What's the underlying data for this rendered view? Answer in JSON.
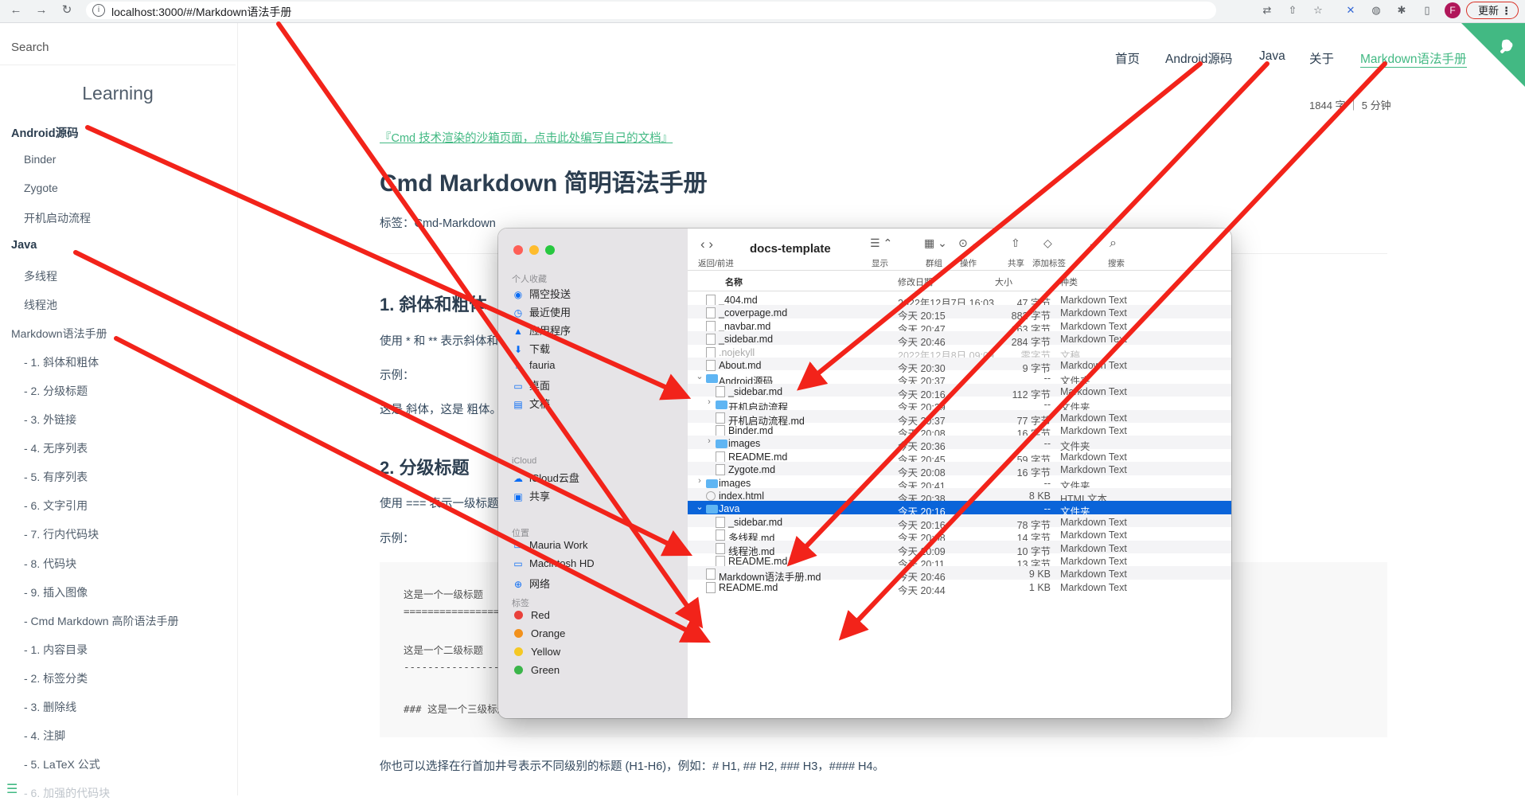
{
  "browser": {
    "url": "localhost:3000/#/Markdown语法手册",
    "avatar": "F",
    "update_label": "更新",
    "menu_glyph": "⋮"
  },
  "sidebar": {
    "search_placeholder": "Search",
    "app_name": "Learning",
    "items": [
      {
        "label": "Android源码",
        "level": 0
      },
      {
        "label": "Binder",
        "level": 1
      },
      {
        "label": "Zygote",
        "level": 1
      },
      {
        "label": "开机启动流程",
        "level": 1
      },
      {
        "label": "Java",
        "level": 0
      },
      {
        "label": "多线程",
        "level": 1
      },
      {
        "label": "线程池",
        "level": 1
      },
      {
        "label": "Markdown语法手册",
        "level": 0
      },
      {
        "label": "- 1. 斜体和粗体",
        "level": 1
      },
      {
        "label": "- 2. 分级标题",
        "level": 1
      },
      {
        "label": "- 3. 外链接",
        "level": 1
      },
      {
        "label": "- 4. 无序列表",
        "level": 1
      },
      {
        "label": "- 5. 有序列表",
        "level": 1
      },
      {
        "label": "- 6. 文字引用",
        "level": 1
      },
      {
        "label": "- 7. 行内代码块",
        "level": 1
      },
      {
        "label": "- 8. 代码块",
        "level": 1
      },
      {
        "label": "- 9. 插入图像",
        "level": 1
      },
      {
        "label": "- Cmd Markdown 高阶语法手册",
        "level": 1
      },
      {
        "label": "- 1. 内容目录",
        "level": 1
      },
      {
        "label": "- 2. 标签分类",
        "level": 1
      },
      {
        "label": "- 3. 删除线",
        "level": 1
      },
      {
        "label": "- 4. 注脚",
        "level": 1
      },
      {
        "label": "- 5. LaTeX 公式",
        "level": 1
      },
      {
        "label": "- 6. 加强的代码块",
        "level": 1
      }
    ]
  },
  "topnav": [
    "首页",
    "Android源码",
    "Java",
    "关于",
    "Markdown语法手册"
  ],
  "content": {
    "wordcount": "1844 字 ｜ 5 分钟",
    "sandbox_link": "『Cmd 技术渲染的沙箱页面，点击此处编写自己的文档』",
    "title": "Cmd Markdown 简明语法手册",
    "tags": "标签：Cmd-Markdown",
    "h2_1": "1. 斜体和粗体",
    "p1": "使用 * 和 ** 表示斜体和粗体。",
    "example1": "示例：",
    "p2": "这是 斜体，这是 粗体。",
    "h2_2": "2. 分级标题",
    "p3": "使用 === 表示一级标题，使用 --- 表示二级标题。",
    "example2": "示例：",
    "code": [
      "这是一个一级标题",
      "============================",
      "这是一个二级标题",
      "--------------------------------",
      "### 这是一个三级标题"
    ],
    "p4": "你也可以选择在行首加井号表示不同级别的标题 (H1-H6)，例如：# H1, ## H2, ### H3，#### H4。"
  },
  "finder": {
    "title": "docs-template",
    "toolbar": [
      {
        "icon": "‹ ›",
        "label": "返回/前进"
      },
      {
        "icon": "☰ ⌃",
        "label": "显示"
      },
      {
        "icon": "▦ ⌄",
        "label": "群组"
      },
      {
        "icon": "⊙ ⌄",
        "label": "操作"
      },
      {
        "icon": "⇧",
        "label": "共享"
      },
      {
        "icon": "◇",
        "label": "添加标签"
      },
      {
        "icon": "⌄",
        "label": ""
      },
      {
        "icon": "⌕",
        "label": "搜索"
      }
    ],
    "columns": {
      "name": "名称",
      "date": "修改日期",
      "size": "大小",
      "kind": "种类"
    },
    "sidebar": {
      "favorites_title": "个人收藏",
      "favorites": [
        {
          "icon": "◉",
          "label": "隔空投送"
        },
        {
          "icon": "◷",
          "label": "最近使用"
        },
        {
          "icon": "▲",
          "label": "应用程序"
        },
        {
          "icon": "⬇",
          "label": "下载"
        },
        {
          "icon": "⌂",
          "label": "fauria"
        },
        {
          "icon": "▭",
          "label": "桌面"
        },
        {
          "icon": "▤",
          "label": "文稿"
        }
      ],
      "icloud_title": "iCloud",
      "icloud": [
        {
          "icon": "☁",
          "label": "iCloud云盘"
        },
        {
          "icon": "▣",
          "label": "共享"
        }
      ],
      "locations_title": "位置",
      "locations": [
        {
          "icon": "▭",
          "label": "Mauria Work"
        },
        {
          "icon": "▭",
          "label": "Macintosh HD"
        },
        {
          "icon": "⊕",
          "label": "网络"
        }
      ],
      "tags_title": "标签",
      "tags": [
        {
          "label": "Red",
          "color": "#e9413b"
        },
        {
          "label": "Orange",
          "color": "#f2911c"
        },
        {
          "label": "Yellow",
          "color": "#f5c824"
        },
        {
          "label": "Green",
          "color": "#3bb54a"
        }
      ]
    },
    "files": [
      {
        "name": "_404.md",
        "date": "2022年12月7日 16:03",
        "size": "47 字节",
        "kind": "Markdown Text",
        "depth": 0,
        "type": "doc"
      },
      {
        "name": "_coverpage.md",
        "date": "今天 20:15",
        "size": "882 字节",
        "kind": "Markdown Text",
        "depth": 0,
        "type": "doc"
      },
      {
        "name": "_navbar.md",
        "date": "今天 20:47",
        "size": "163 字节",
        "kind": "Markdown Text",
        "depth": 0,
        "type": "doc"
      },
      {
        "name": "_sidebar.md",
        "date": "今天 20:46",
        "size": "284 字节",
        "kind": "Markdown Text",
        "depth": 0,
        "type": "doc"
      },
      {
        "name": ".nojekyll",
        "date": "2022年12月8日 09:09",
        "size": "零字节",
        "kind": "文稿",
        "depth": 0,
        "type": "doc",
        "dim": true
      },
      {
        "name": "About.md",
        "date": "今天 20:30",
        "size": "9 字节",
        "kind": "Markdown Text",
        "depth": 0,
        "type": "doc"
      },
      {
        "name": "Android源码",
        "date": "今天 20:37",
        "size": "--",
        "kind": "文件夹",
        "depth": 0,
        "type": "folder",
        "disc": "⌄"
      },
      {
        "name": "_sidebar.md",
        "date": "今天 20:16",
        "size": "112 字节",
        "kind": "Markdown Text",
        "depth": 1,
        "type": "doc"
      },
      {
        "name": "开机启动流程",
        "date": "今天 20:39",
        "size": "--",
        "kind": "文件夹",
        "depth": 1,
        "type": "folder",
        "disc": "›"
      },
      {
        "name": "开机启动流程.md",
        "date": "今天 20:37",
        "size": "77 字节",
        "kind": "Markdown Text",
        "depth": 1,
        "type": "doc"
      },
      {
        "name": "Binder.md",
        "date": "今天 20:08",
        "size": "16 字节",
        "kind": "Markdown Text",
        "depth": 1,
        "type": "doc"
      },
      {
        "name": "images",
        "date": "今天 20:36",
        "size": "--",
        "kind": "文件夹",
        "depth": 1,
        "type": "folder",
        "disc": "›"
      },
      {
        "name": "README.md",
        "date": "今天 20:45",
        "size": "59 字节",
        "kind": "Markdown Text",
        "depth": 1,
        "type": "doc"
      },
      {
        "name": "Zygote.md",
        "date": "今天 20:08",
        "size": "16 字节",
        "kind": "Markdown Text",
        "depth": 1,
        "type": "doc"
      },
      {
        "name": "images",
        "date": "今天 20:41",
        "size": "--",
        "kind": "文件夹",
        "depth": 0,
        "type": "folder",
        "disc": "›"
      },
      {
        "name": "index.html",
        "date": "今天 20:38",
        "size": "8 KB",
        "kind": "HTML文本",
        "depth": 0,
        "type": "html"
      },
      {
        "name": "Java",
        "date": "今天 20:16",
        "size": "--",
        "kind": "文件夹",
        "depth": 0,
        "type": "folder",
        "disc": "⌄",
        "selected": true
      },
      {
        "name": "_sidebar.md",
        "date": "今天 20:16",
        "size": "78 字节",
        "kind": "Markdown Text",
        "depth": 1,
        "type": "doc"
      },
      {
        "name": "多线程.md",
        "date": "今天 20:08",
        "size": "14 字节",
        "kind": "Markdown Text",
        "depth": 1,
        "type": "doc"
      },
      {
        "name": "线程池.md",
        "date": "今天 20:09",
        "size": "10 字节",
        "kind": "Markdown Text",
        "depth": 1,
        "type": "doc"
      },
      {
        "name": "README.md",
        "date": "今天 20:11",
        "size": "13 字节",
        "kind": "Markdown Text",
        "depth": 1,
        "type": "doc"
      },
      {
        "name": "Markdown语法手册.md",
        "date": "今天 20:46",
        "size": "9 KB",
        "kind": "Markdown Text",
        "depth": 0,
        "type": "doc"
      },
      {
        "name": "README.md",
        "date": "今天 20:44",
        "size": "1 KB",
        "kind": "Markdown Text",
        "depth": 0,
        "type": "doc"
      }
    ]
  },
  "colors": {
    "accent": "#42b983",
    "annotation_arrow": "#f2231a",
    "selection": "#0a64d9"
  }
}
